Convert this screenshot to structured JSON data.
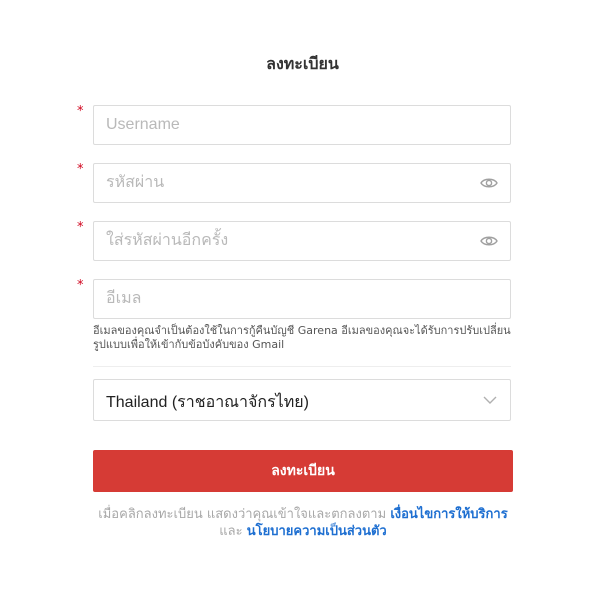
{
  "title": "ลงทะเบียน",
  "required_mark": "*",
  "fields": {
    "username": {
      "placeholder": "Username",
      "value": ""
    },
    "password": {
      "placeholder": "รหัสผ่าน",
      "value": ""
    },
    "password_confirm": {
      "placeholder": "ใส่รหัสผ่านอีกครั้ง",
      "value": ""
    },
    "email": {
      "placeholder": "อีเมล",
      "value": ""
    }
  },
  "email_hint": "อีเมลของคุณจำเป็นต้องใช้ในการกู้คืนบัญชี Garena อีเมลของคุณจะได้รับการปรับเปลี่ยนรูปแบบเพื่อให้เข้ากับข้อบังคับของ Gmail",
  "region_select": {
    "selected": "Thailand (ราชอาณาจักรไทย)"
  },
  "submit_label": "ลงทะเบียน",
  "terms": {
    "prefix": "เมื่อคลิกลงทะเบียน แสดงว่าคุณเข้าใจและตกลงตาม",
    "terms_link": "เงื่อนไขการให้บริการ",
    "and": "และ",
    "privacy_link": "นโยบายความเป็นส่วนตัว"
  },
  "icons": {
    "eye": "eye-icon",
    "chevron": "chevron-down-icon"
  },
  "colors": {
    "accent": "#d63b35",
    "link": "#1e6fd1",
    "required": "#d0021b"
  }
}
